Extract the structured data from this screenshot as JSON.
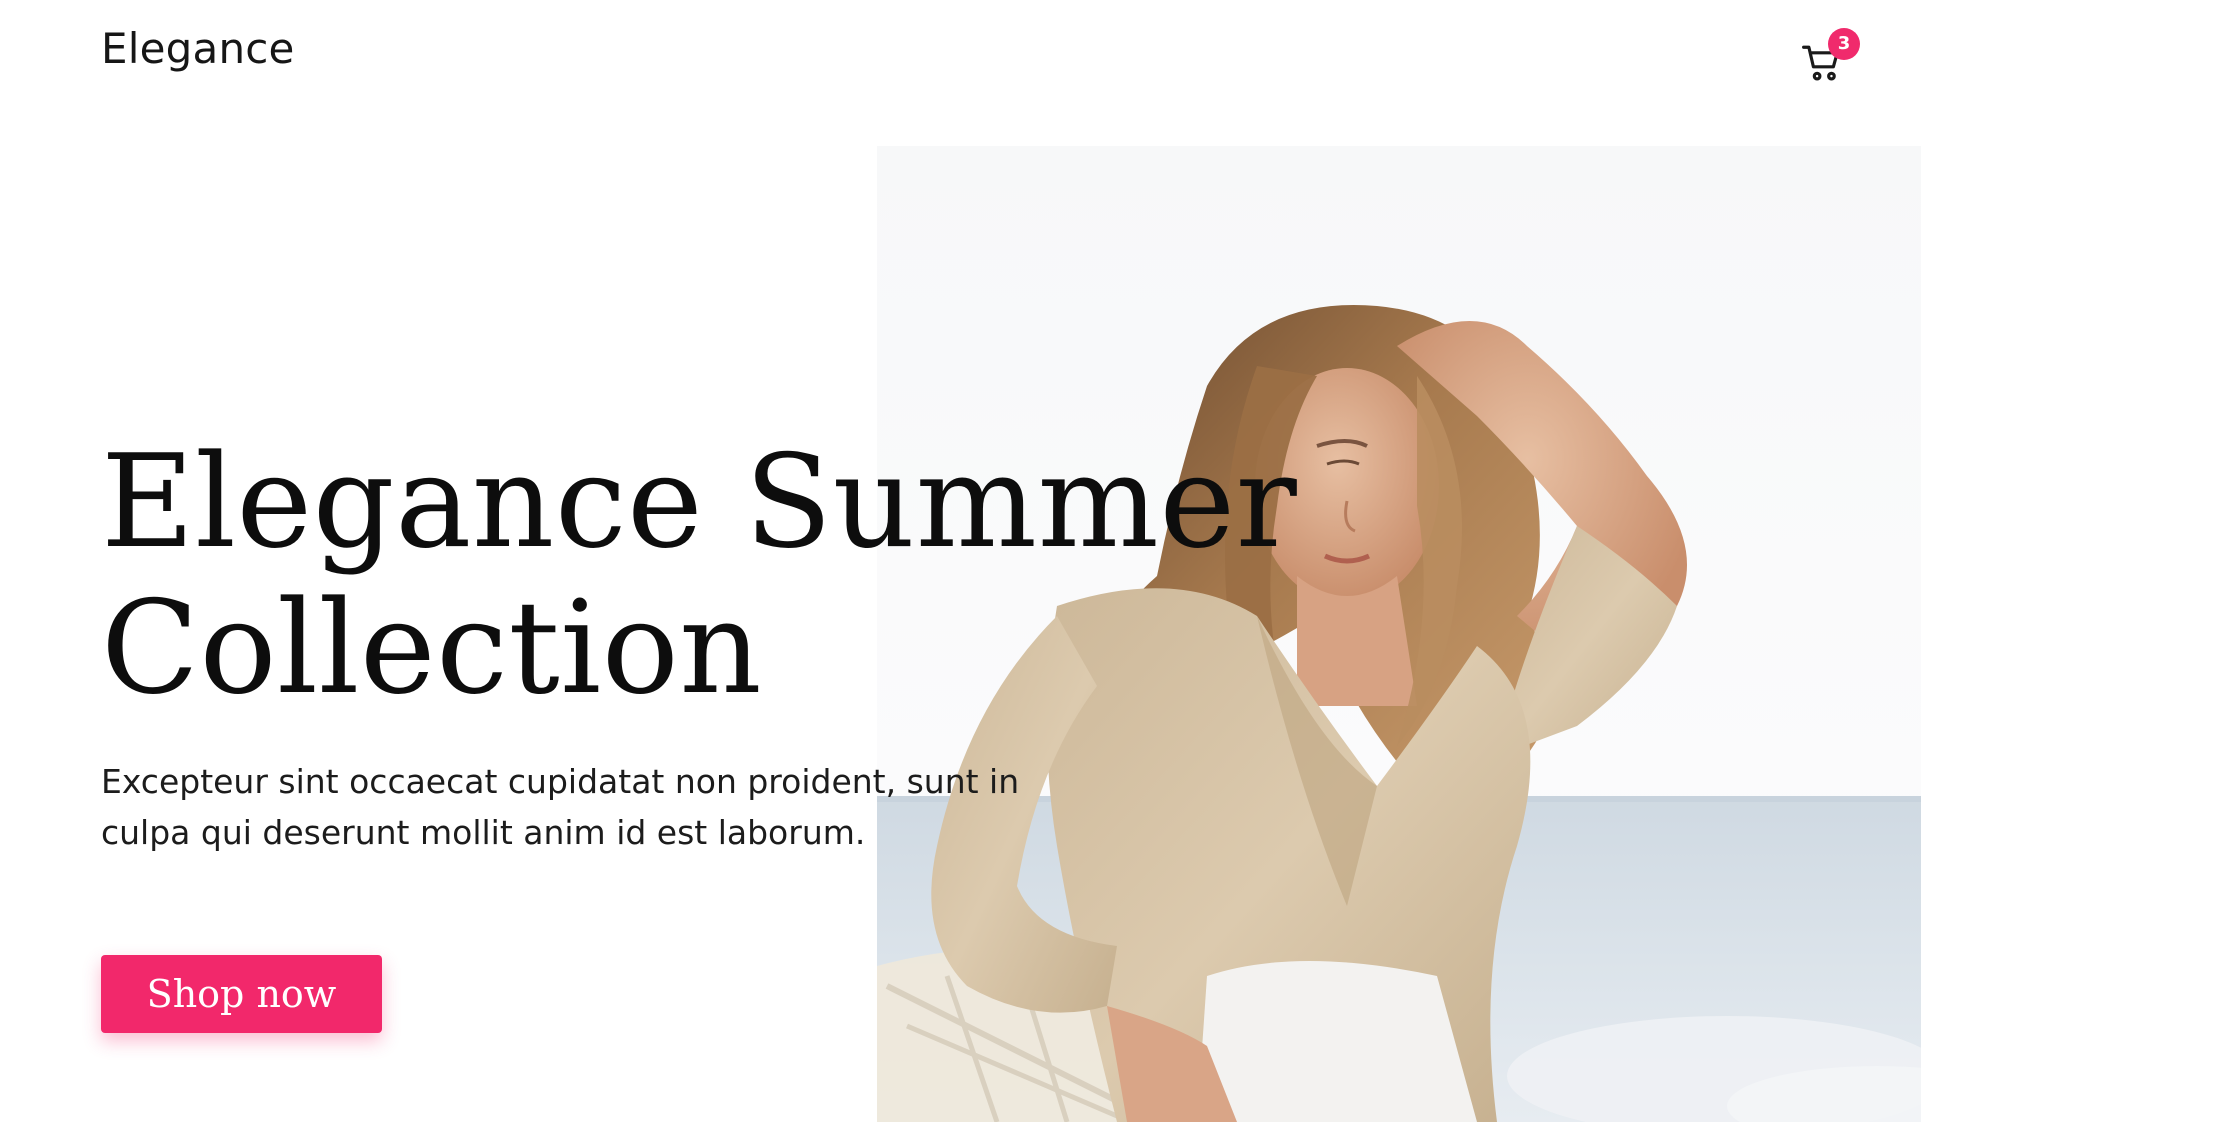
{
  "header": {
    "brand": "Elegance",
    "cart": {
      "icon": "shopping-cart-icon",
      "badge_count": "3"
    }
  },
  "hero": {
    "title_line1": "Elegance Summer",
    "title_line2": "Collection",
    "description": "Excepteur sint occaecat cupidatat non proident, sunt in culpa qui deserunt mollit anim id est laborum.",
    "cta_label": "Shop now",
    "image": "woman-in-beige-blouse-by-sea-photo"
  },
  "colors": {
    "accent": "#f2286b",
    "badge": "#f02a6c",
    "text": "#111111",
    "background": "#ffffff"
  }
}
